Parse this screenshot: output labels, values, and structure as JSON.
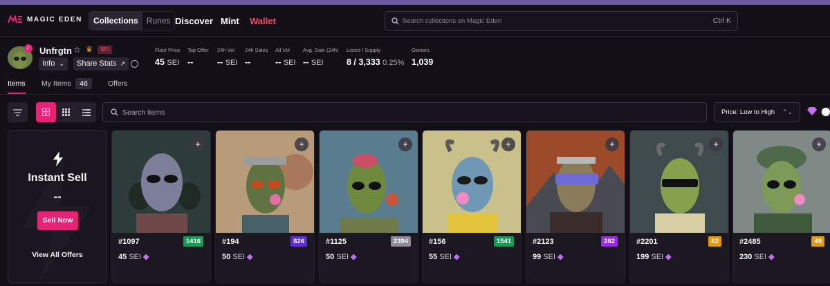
{
  "nav": {
    "brand": "MAGIC EDEN",
    "segments": [
      "Collections",
      "Runes"
    ],
    "links": [
      "Discover",
      "Mint",
      "Wallet"
    ],
    "search_placeholder": "Search collections on Magic Eden",
    "search_shortcut": "Ctrl K"
  },
  "collection": {
    "name": "Unfrgtn",
    "chain": "SEI",
    "info_label": "Info",
    "share_label": "Share Stats",
    "stats": [
      {
        "label": "Floor Price",
        "value": "45",
        "unit": "SEI"
      },
      {
        "label": "Top Offer",
        "value": "--",
        "unit": ""
      },
      {
        "label": "24h Vol",
        "value": "--",
        "unit": "SEI"
      },
      {
        "label": "24h Sales",
        "value": "--",
        "unit": ""
      },
      {
        "label": "All Vol",
        "value": "--",
        "unit": "SEI"
      },
      {
        "label": "Avg. Sale (24h)",
        "value": "--",
        "unit": "SEI"
      },
      {
        "label": "Listed / Supply",
        "value": "8 / 3,333",
        "unit": "0.25%"
      },
      {
        "label": "Owners",
        "value": "1,039",
        "unit": ""
      }
    ]
  },
  "tabs": {
    "items": "Items",
    "my_items": "My Items",
    "my_items_count": "46",
    "offers": "Offers"
  },
  "toolbar": {
    "search_placeholder": "Search items",
    "sort_label": "Price: Low to High"
  },
  "instant_sell": {
    "title": "Instant Sell",
    "value": "--",
    "button": "Sell Now",
    "link": "View All Offers"
  },
  "cards": [
    {
      "id": "#1097",
      "rank": "1416",
      "rank_color": "#1a9a57",
      "price": "45",
      "unit": "SEI"
    },
    {
      "id": "#194",
      "rank": "826",
      "rank_color": "#5b2ed6",
      "price": "50",
      "unit": "SEI"
    },
    {
      "id": "#1125",
      "rank": "2394",
      "rank_color": "#8f8a98",
      "price": "50",
      "unit": "SEI"
    },
    {
      "id": "#156",
      "rank": "1541",
      "rank_color": "#1a9a57",
      "price": "55",
      "unit": "SEI"
    },
    {
      "id": "#2123",
      "rank": "282",
      "rank_color": "#9b2be0",
      "price": "99",
      "unit": "SEI"
    },
    {
      "id": "#2201",
      "rank": "62",
      "rank_color": "#e09a13",
      "price": "199",
      "unit": "SEI"
    },
    {
      "id": "#2485",
      "rank": "49",
      "rank_color": "#e09a13",
      "price": "230",
      "unit": "SEI"
    }
  ],
  "colors": {
    "accent": "#e42575",
    "wallet": "#f24b6a",
    "background": "#120f17",
    "card": "#1c1822"
  }
}
